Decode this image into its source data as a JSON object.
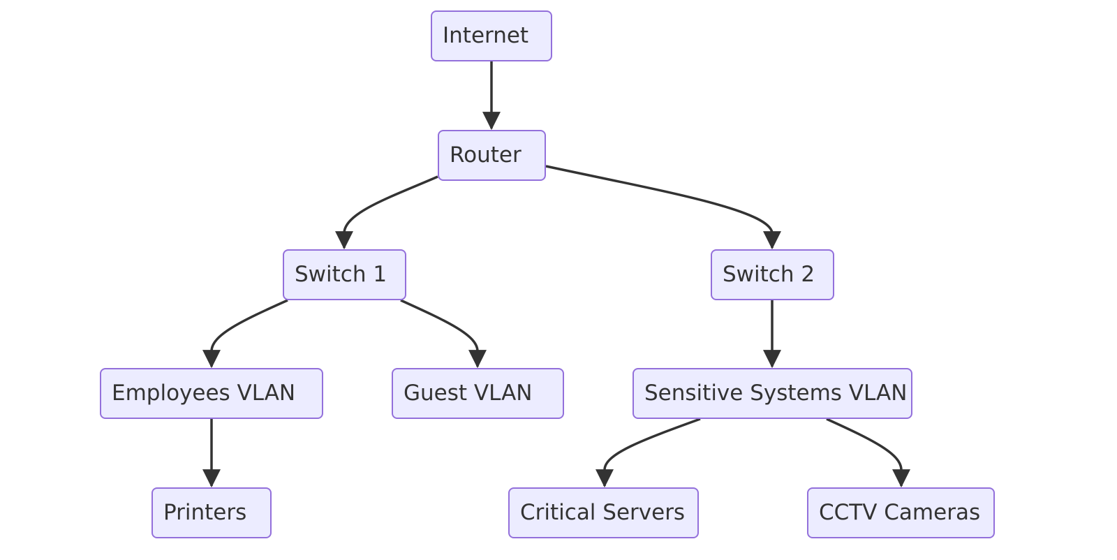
{
  "diagram": {
    "type": "flowchart-top-down",
    "colors": {
      "node_fill": "#ececff",
      "node_border": "#9370db",
      "edge": "#333333",
      "text": "#333333"
    },
    "nodes": [
      {
        "id": "internet",
        "label": "Internet"
      },
      {
        "id": "router",
        "label": "Router"
      },
      {
        "id": "switch1",
        "label": "Switch 1"
      },
      {
        "id": "switch2",
        "label": "Switch 2"
      },
      {
        "id": "employees_vlan",
        "label": "Employees VLAN"
      },
      {
        "id": "guest_vlan",
        "label": "Guest VLAN"
      },
      {
        "id": "sensitive_vlan",
        "label": "Sensitive Systems VLAN"
      },
      {
        "id": "printers",
        "label": "Printers"
      },
      {
        "id": "critical_servers",
        "label": "Critical Servers"
      },
      {
        "id": "cctv_cameras",
        "label": "CCTV Cameras"
      }
    ],
    "edges": [
      {
        "from": "internet",
        "to": "router"
      },
      {
        "from": "router",
        "to": "switch1"
      },
      {
        "from": "router",
        "to": "switch2"
      },
      {
        "from": "switch1",
        "to": "employees_vlan"
      },
      {
        "from": "switch1",
        "to": "guest_vlan"
      },
      {
        "from": "switch2",
        "to": "sensitive_vlan"
      },
      {
        "from": "employees_vlan",
        "to": "printers"
      },
      {
        "from": "sensitive_vlan",
        "to": "critical_servers"
      },
      {
        "from": "sensitive_vlan",
        "to": "cctv_cameras"
      }
    ]
  }
}
